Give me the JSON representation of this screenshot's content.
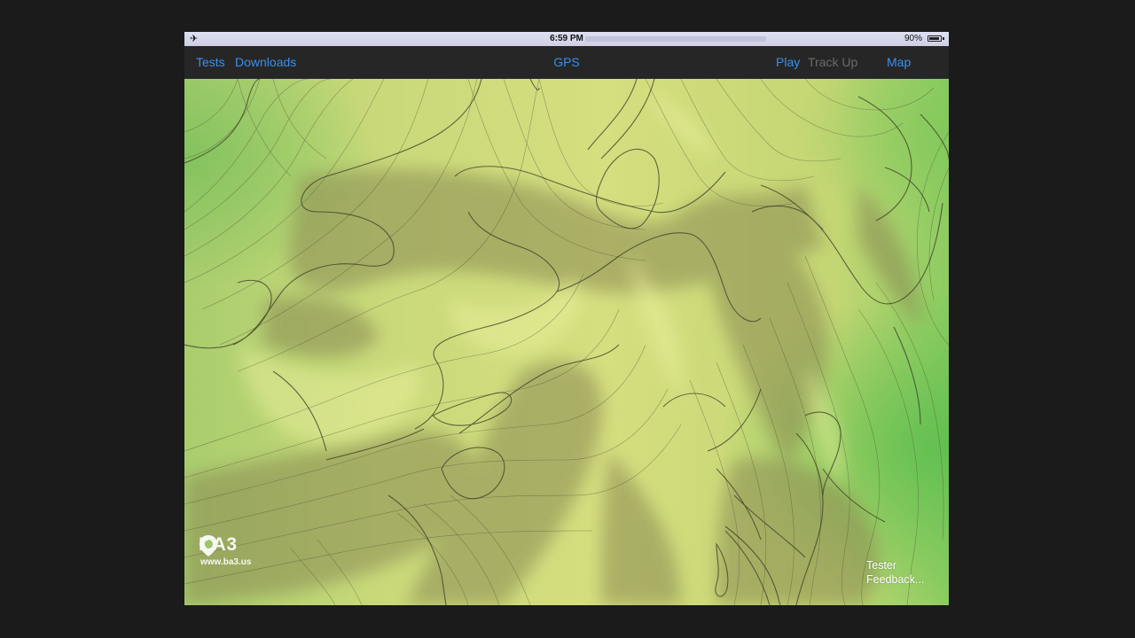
{
  "status_bar": {
    "airplane_icon": "airplane-icon",
    "time": "6:59 PM",
    "battery_percent": "90%",
    "battery_level": 0.9
  },
  "nav": {
    "tests_label": "Tests",
    "downloads_label": "Downloads",
    "title": "GPS",
    "play_label": "Play",
    "track_up_label": "Track Up",
    "map_label": "Map",
    "accent_color": "#3a8ff0"
  },
  "map": {
    "logo_text": "BA3",
    "logo_url": "www.ba3.us",
    "feedback_line1": "Tester",
    "feedback_line2": "Feedback..."
  }
}
